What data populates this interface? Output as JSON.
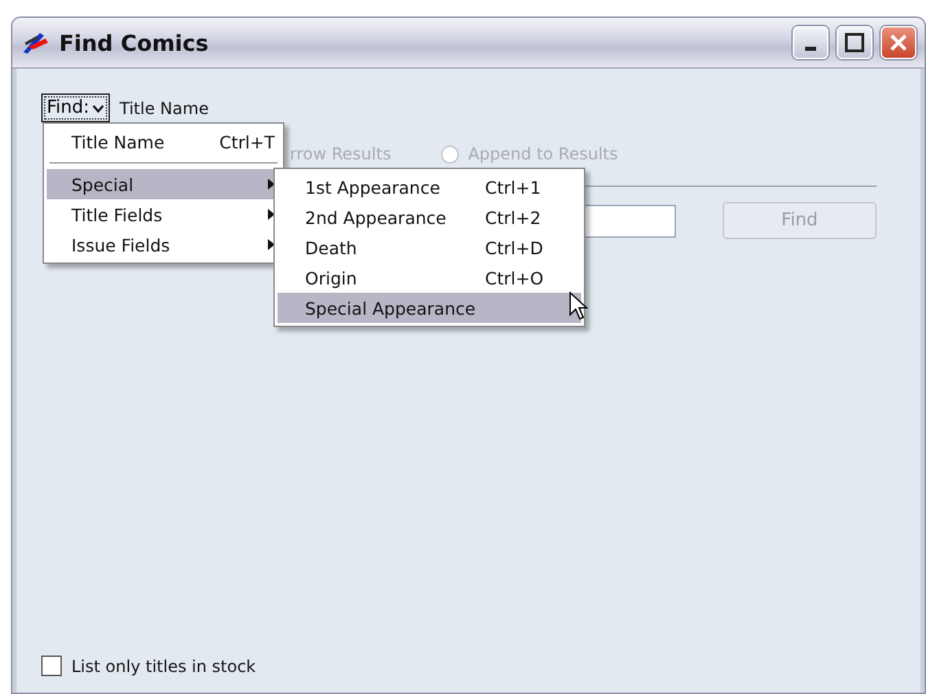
{
  "window": {
    "title": "Find Comics"
  },
  "find_dropdown": {
    "label": "Find:",
    "value": "Title Name"
  },
  "options": [
    {
      "label": "rrow Results",
      "disabled": true,
      "kind": "text"
    },
    {
      "label": "Append to Results",
      "selected": false,
      "disabled": true,
      "kind": "radio"
    }
  ],
  "find_button": {
    "label": "Find",
    "disabled": true
  },
  "menu": [
    {
      "kind": "item",
      "label": "Title Name",
      "shortcut": "Ctrl+T",
      "selected": false
    },
    {
      "kind": "separator"
    },
    {
      "kind": "submenu",
      "label": "Special",
      "selected": true
    },
    {
      "kind": "submenu",
      "label": "Title Fields",
      "selected": false
    },
    {
      "kind": "submenu",
      "label": "Issue Fields",
      "selected": false
    }
  ],
  "submenu": [
    {
      "label": "1st Appearance",
      "shortcut": "Ctrl+1",
      "selected": false
    },
    {
      "label": "2nd Appearance",
      "shortcut": "Ctrl+2",
      "selected": false
    },
    {
      "label": "Death",
      "shortcut": "Ctrl+D",
      "selected": false
    },
    {
      "label": "Origin",
      "shortcut": "Ctrl+O",
      "selected": false
    },
    {
      "label": "Special Appearance",
      "selected": true
    }
  ],
  "stock_checkbox": {
    "label": "List only titles in stock",
    "checked": false
  }
}
